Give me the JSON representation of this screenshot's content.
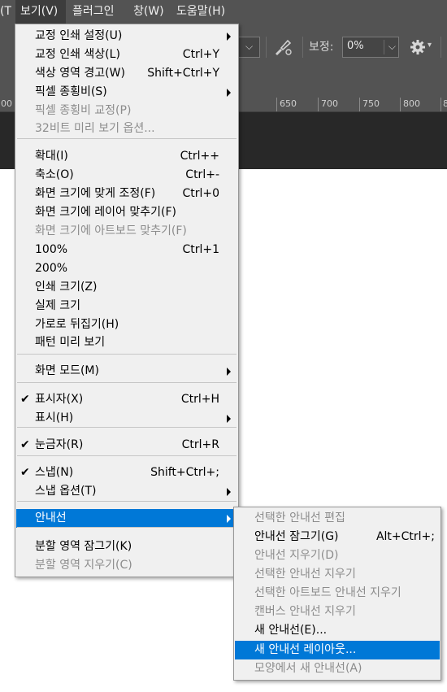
{
  "menubar": {
    "prev_tail": "T)",
    "view": "보기(V)",
    "plugin": "플러그인",
    "window": "창(W)",
    "help": "도움말(H)"
  },
  "options_bar": {
    "smoothing_label": "보정:",
    "smoothing_value": "0%"
  },
  "ruler": {
    "ticks": [
      "00",
      "650",
      "700",
      "750",
      "800",
      "8"
    ]
  },
  "main_menu": {
    "items": [
      {
        "label": "교정 인쇄 설정(U)",
        "shortcut": "",
        "submenu": true,
        "disabled": false,
        "checked": false
      },
      {
        "label": "교정 인쇄 색상(L)",
        "shortcut": "Ctrl+Y",
        "submenu": false,
        "disabled": false,
        "checked": false
      },
      {
        "label": "색상 영역 경고(W)",
        "shortcut": "Shift+Ctrl+Y",
        "submenu": false,
        "disabled": false,
        "checked": false
      },
      {
        "label": "픽셀 종횡비(S)",
        "shortcut": "",
        "submenu": true,
        "disabled": false,
        "checked": false
      },
      {
        "label": "픽셀 종횡비 교정(P)",
        "shortcut": "",
        "submenu": false,
        "disabled": true,
        "checked": false
      },
      {
        "label": "32비트 미리 보기 옵션...",
        "shortcut": "",
        "submenu": false,
        "disabled": true,
        "checked": false
      },
      {
        "label": "확대(I)",
        "shortcut": "Ctrl++",
        "submenu": false,
        "disabled": false,
        "checked": false
      },
      {
        "label": "축소(O)",
        "shortcut": "Ctrl+-",
        "submenu": false,
        "disabled": false,
        "checked": false
      },
      {
        "label": "화면 크기에 맞게 조정(F)",
        "shortcut": "Ctrl+0",
        "submenu": false,
        "disabled": false,
        "checked": false
      },
      {
        "label": "화면 크기에 레이어 맞추기(F)",
        "shortcut": "",
        "submenu": false,
        "disabled": false,
        "checked": false
      },
      {
        "label": "화면 크기에 아트보드 맞추기(F)",
        "shortcut": "",
        "submenu": false,
        "disabled": true,
        "checked": false
      },
      {
        "label": "100%",
        "shortcut": "Ctrl+1",
        "submenu": false,
        "disabled": false,
        "checked": false
      },
      {
        "label": "200%",
        "shortcut": "",
        "submenu": false,
        "disabled": false,
        "checked": false
      },
      {
        "label": "인쇄 크기(Z)",
        "shortcut": "",
        "submenu": false,
        "disabled": false,
        "checked": false
      },
      {
        "label": "실제 크기",
        "shortcut": "",
        "submenu": false,
        "disabled": false,
        "checked": false
      },
      {
        "label": "가로로 뒤집기(H)",
        "shortcut": "",
        "submenu": false,
        "disabled": false,
        "checked": false
      },
      {
        "label": "패턴 미리 보기",
        "shortcut": "",
        "submenu": false,
        "disabled": false,
        "checked": false
      },
      {
        "label": "화면 모드(M)",
        "shortcut": "",
        "submenu": true,
        "disabled": false,
        "checked": false
      },
      {
        "label": "표시자(X)",
        "shortcut": "Ctrl+H",
        "submenu": false,
        "disabled": false,
        "checked": true
      },
      {
        "label": "표시(H)",
        "shortcut": "",
        "submenu": true,
        "disabled": false,
        "checked": false
      },
      {
        "label": "눈금자(R)",
        "shortcut": "Ctrl+R",
        "submenu": false,
        "disabled": false,
        "checked": true
      },
      {
        "label": "스냅(N)",
        "shortcut": "Shift+Ctrl+;",
        "submenu": false,
        "disabled": false,
        "checked": true
      },
      {
        "label": "스냅 옵션(T)",
        "shortcut": "",
        "submenu": true,
        "disabled": false,
        "checked": false
      },
      {
        "label": "안내선",
        "shortcut": "",
        "submenu": true,
        "disabled": false,
        "checked": false,
        "highlighted": true
      },
      {
        "label": "분할 영역 잠그기(K)",
        "shortcut": "",
        "submenu": false,
        "disabled": false,
        "checked": false
      },
      {
        "label": "분할 영역 지우기(C)",
        "shortcut": "",
        "submenu": false,
        "disabled": true,
        "checked": false
      }
    ]
  },
  "guides_submenu": {
    "items": [
      {
        "label": "선택한 안내선 편집",
        "shortcut": "",
        "disabled": true
      },
      {
        "label": "안내선 잠그기(G)",
        "shortcut": "Alt+Ctrl+;",
        "disabled": false
      },
      {
        "label": "안내선 지우기(D)",
        "shortcut": "",
        "disabled": true
      },
      {
        "label": "선택한 안내선 지우기",
        "shortcut": "",
        "disabled": true
      },
      {
        "label": "선택한 아트보드 안내선 지우기",
        "shortcut": "",
        "disabled": true
      },
      {
        "label": "캔버스 안내선 지우기",
        "shortcut": "",
        "disabled": true
      },
      {
        "label": "새 안내선(E)...",
        "shortcut": "",
        "disabled": false
      },
      {
        "label": "새 안내선 레이아웃...",
        "shortcut": "",
        "disabled": false,
        "highlighted": true
      },
      {
        "label": "모양에서 새 안내선(A)",
        "shortcut": "",
        "disabled": true
      }
    ]
  },
  "check_glyph": "✔"
}
